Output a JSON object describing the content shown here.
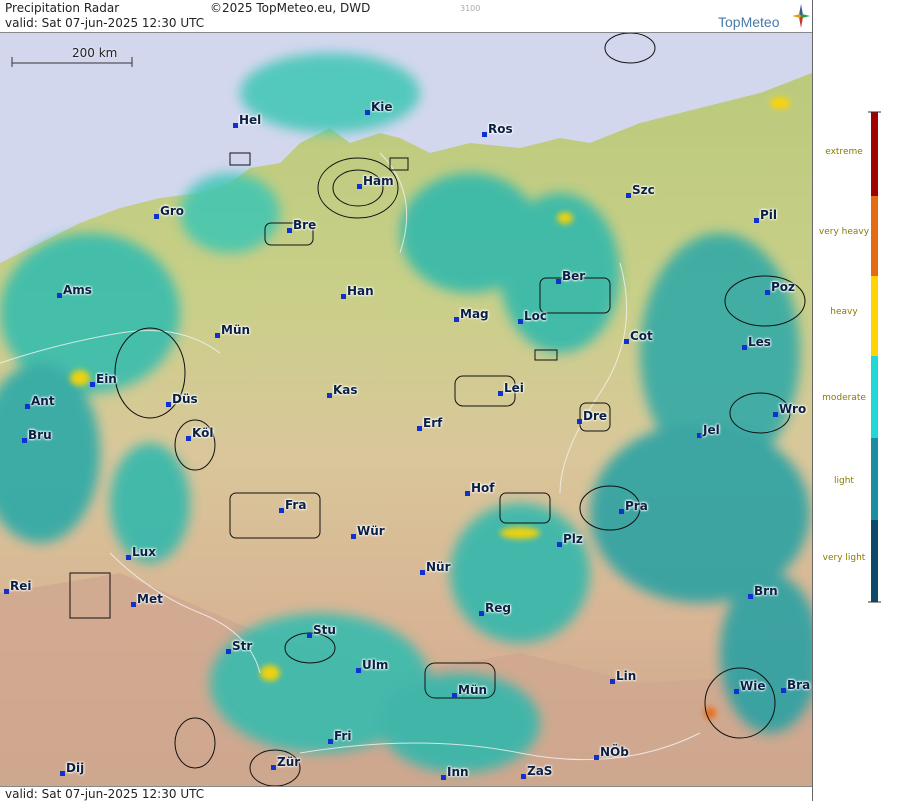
{
  "header": {
    "title": "Precipitation Radar",
    "copyright": "©2025 TopMeteo.eu, DWD",
    "code": "3100",
    "valid": "valid:  Sat  07-jun-2025 12:30 UTC",
    "logo": "TopMeteo"
  },
  "footer": {
    "valid": "valid:  Sat  07-jun-2025 12:30 UTC"
  },
  "scale_bar": {
    "label": "200 km"
  },
  "legend": {
    "levels": [
      {
        "label": "extreme",
        "color": "#a00000"
      },
      {
        "label": "very heavy",
        "color": "#e86a10"
      },
      {
        "label": "heavy",
        "color": "#ffd400"
      },
      {
        "label": "moderate",
        "color": "#20d8d8"
      },
      {
        "label": "light",
        "color": "#1a8ea0"
      },
      {
        "label": "very light",
        "color": "#0c4a6a"
      }
    ]
  },
  "cities": [
    {
      "name": "Hel"
    },
    {
      "name": "Kie"
    },
    {
      "name": "Ros"
    },
    {
      "name": "Ham"
    },
    {
      "name": "Szc"
    },
    {
      "name": "Gro"
    },
    {
      "name": "Bre"
    },
    {
      "name": "Pil"
    },
    {
      "name": "Ams"
    },
    {
      "name": "Han"
    },
    {
      "name": "Ber"
    },
    {
      "name": "Poz"
    },
    {
      "name": "Mün"
    },
    {
      "name": "Mag"
    },
    {
      "name": "Loc"
    },
    {
      "name": "Cot"
    },
    {
      "name": "Les"
    },
    {
      "name": "Ein"
    },
    {
      "name": "Kas"
    },
    {
      "name": "Lei"
    },
    {
      "name": "Ant"
    },
    {
      "name": "Düs"
    },
    {
      "name": "Dre"
    },
    {
      "name": "Wro"
    },
    {
      "name": "Bru"
    },
    {
      "name": "Köl"
    },
    {
      "name": "Erf"
    },
    {
      "name": "Jel"
    },
    {
      "name": "Hof"
    },
    {
      "name": "Fra"
    },
    {
      "name": "Pra"
    },
    {
      "name": "Wür"
    },
    {
      "name": "Plz"
    },
    {
      "name": "Lux"
    },
    {
      "name": "Nür"
    },
    {
      "name": "Rei"
    },
    {
      "name": "Met"
    },
    {
      "name": "Reg"
    },
    {
      "name": "Brn"
    },
    {
      "name": "Str"
    },
    {
      "name": "Stu"
    },
    {
      "name": "Ulm"
    },
    {
      "name": "Lin"
    },
    {
      "name": "Mün"
    },
    {
      "name": "Wie"
    },
    {
      "name": "Bra"
    },
    {
      "name": "Fri"
    },
    {
      "name": "NÖb"
    },
    {
      "name": "Dij"
    },
    {
      "name": "Zür"
    },
    {
      "name": "Inn"
    },
    {
      "name": "ZaS"
    }
  ]
}
